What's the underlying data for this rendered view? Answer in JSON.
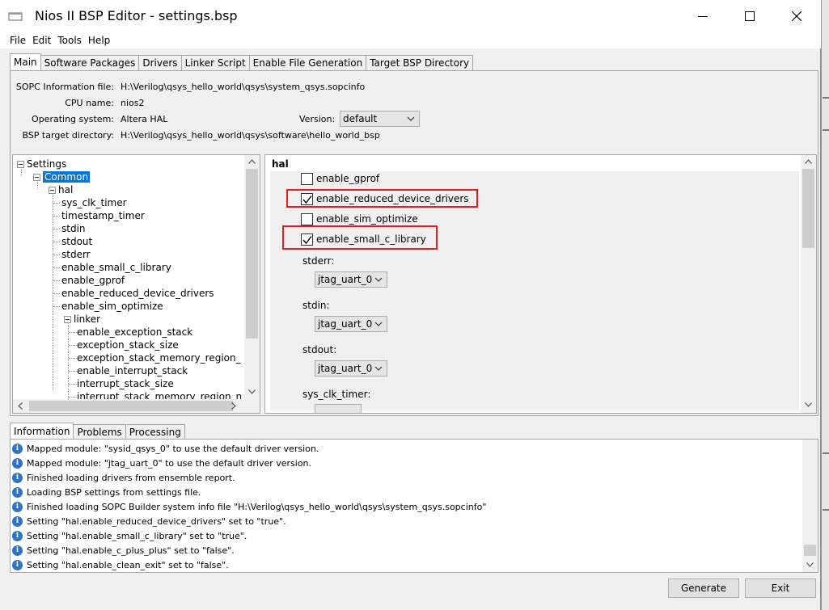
{
  "window": {
    "title": "Nios II BSP Editor - settings.bsp"
  },
  "menu": [
    "File",
    "Edit",
    "Tools",
    "Help"
  ],
  "main_tabs": [
    "Main",
    "Software Packages",
    "Drivers",
    "Linker Script",
    "Enable File Generation",
    "Target BSP Directory"
  ],
  "info_fields": {
    "sopc_label": "SOPC Information file:",
    "sopc_value": "H:\\Verilog\\qsys_hello_world\\qsys\\system_qsys.sopcinfo",
    "cpu_label": "CPU name:",
    "cpu_value": "nios2",
    "os_label": "Operating system:",
    "os_value": "Altera HAL",
    "version_label": "Version:",
    "version_value": "default",
    "bsp_label": "BSP target directory:",
    "bsp_value": "H:\\Verilog\\qsys_hello_world\\qsys\\software\\hello_world_bsp"
  },
  "tree": {
    "settings": "Settings",
    "common": "Common",
    "hal": "hal",
    "hal_children": [
      "sys_clk_timer",
      "timestamp_timer",
      "stdin",
      "stdout",
      "stderr",
      "enable_small_c_library",
      "enable_gprof",
      "enable_reduced_device_drivers",
      "enable_sim_optimize"
    ],
    "linker": "linker",
    "linker_children": [
      "enable_exception_stack",
      "exception_stack_size",
      "exception_stack_memory_region_",
      "enable_interrupt_stack",
      "interrupt_stack_size",
      "interrupt_stack_memory_region_n"
    ]
  },
  "hal_panel": {
    "title": "hal",
    "checkboxes": [
      {
        "label": "enable_gprof",
        "checked": false
      },
      {
        "label": "enable_reduced_device_drivers",
        "checked": true
      },
      {
        "label": "enable_sim_optimize",
        "checked": false
      },
      {
        "label": "enable_small_c_library",
        "checked": true
      }
    ],
    "stderr_label": "stderr:",
    "stderr_value": "jtag_uart_0",
    "stdin_label": "stdin:",
    "stdin_value": "jtag_uart_0",
    "stdout_label": "stdout:",
    "stdout_value": "jtag_uart_0",
    "sys_clk_label": "sys_clk_timer:"
  },
  "info_tabs": [
    "Information",
    "Problems",
    "Processing"
  ],
  "messages": [
    "Mapped module: \"sysid_qsys_0\" to use the default driver version.",
    "Mapped module: \"jtag_uart_0\" to use the default driver version.",
    "Finished loading drivers from ensemble report.",
    "Loading BSP settings from settings file.",
    "Finished loading SOPC Builder system info file \"H:\\Verilog\\qsys_hello_world\\qsys\\system_qsys.sopcinfo\"",
    "Setting \"hal.enable_reduced_device_drivers\" set to \"true\".",
    "Setting \"hal.enable_small_c_library\" set to \"true\".",
    "Setting \"hal.enable_c_plus_plus\" set to \"false\".",
    "Setting \"hal.enable_clean_exit\" set to \"false\"."
  ],
  "buttons": {
    "generate": "Generate",
    "exit": "Exit"
  },
  "icons": {
    "app": "app-window-icon",
    "info": "info-icon",
    "check": "checkmark-icon"
  },
  "colors": {
    "selection": "#0078d7",
    "highlight_box": "#e02020",
    "info_icon": "#2f73c5"
  }
}
